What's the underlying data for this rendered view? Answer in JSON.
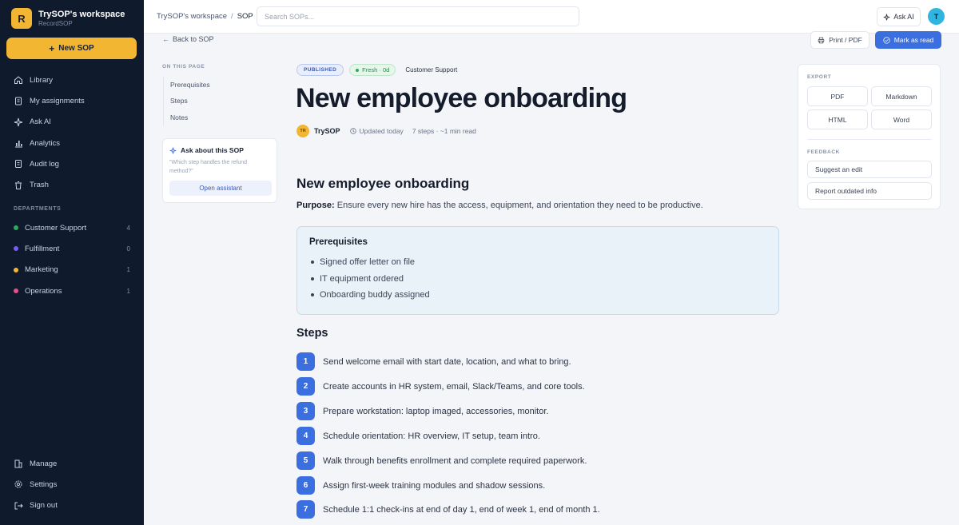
{
  "workspace": {
    "initial": "R",
    "name": "TrySOP's workspace",
    "subtitle": "RecordSOP"
  },
  "sidebar": {
    "new_button": "New SOP",
    "nav": [
      {
        "label": "Library",
        "icon": "home-icon"
      },
      {
        "label": "My assignments",
        "icon": "clipboard-icon"
      },
      {
        "label": "Ask AI",
        "icon": "sparkle-icon"
      },
      {
        "label": "Analytics",
        "icon": "bar-chart-icon"
      },
      {
        "label": "Audit log",
        "icon": "document-icon"
      },
      {
        "label": "Trash",
        "icon": "trash-icon"
      }
    ],
    "departments_title": "DEPARTMENTS",
    "departments": [
      {
        "label": "Customer Support",
        "count": "4",
        "color": "#2fa85a"
      },
      {
        "label": "Fulfillment",
        "count": "0",
        "color": "#7a5cf0"
      },
      {
        "label": "Marketing",
        "count": "1",
        "color": "#f2b632"
      },
      {
        "label": "Operations",
        "count": "1",
        "color": "#e8508a"
      }
    ],
    "bottom": [
      {
        "label": "Manage",
        "icon": "building-icon"
      },
      {
        "label": "Settings",
        "icon": "gear-icon"
      },
      {
        "label": "Sign out",
        "icon": "sign-out-icon"
      }
    ]
  },
  "topbar": {
    "breadcrumb_workspace": "TrySOP's workspace",
    "breadcrumb_sep": "/",
    "breadcrumb_current": "SOP",
    "search_placeholder": "Search SOPs...",
    "ask_ai": "Ask AI",
    "avatar": "T"
  },
  "actions": {
    "back": "Back to SOP",
    "print": "Print / PDF",
    "mark_read": "Mark as read"
  },
  "toc": {
    "title": "ON THIS PAGE",
    "items": [
      "Prerequisites",
      "Steps",
      "Notes"
    ],
    "ask_title": "Ask about this SOP",
    "ask_hint": "\"Which step handles the refund method?\"",
    "ask_button": "Open assistant"
  },
  "sop": {
    "status": "PUBLISHED",
    "freshness": "Fresh · 0d",
    "department": "Customer Support",
    "title": "New employee onboarding",
    "author_initials": "TR",
    "author": "TrySOP",
    "updated": "Updated today",
    "steps_meta": "7 steps · ~1 min read",
    "heading": "New employee onboarding",
    "purpose_label": "Purpose:",
    "purpose": "Ensure every new hire has the access, equipment, and orientation they need to be productive.",
    "prereq_title": "Prerequisites",
    "prerequisites": [
      "Signed offer letter on file",
      "IT equipment ordered",
      "Onboarding buddy assigned"
    ],
    "steps_title": "Steps",
    "steps": [
      {
        "n": "1",
        "text": "Send welcome email with start date, location, and what to bring."
      },
      {
        "n": "2",
        "text": "Create accounts in HR system, email, Slack/Teams, and core tools."
      },
      {
        "n": "3",
        "text": "Prepare workstation: laptop imaged, accessories, monitor."
      },
      {
        "n": "4",
        "text": "Schedule orientation: HR overview, IT setup, team intro."
      },
      {
        "n": "5",
        "text": "Walk through benefits enrollment and complete required paperwork."
      },
      {
        "n": "6",
        "text": "Assign first-week training modules and shadow sessions."
      },
      {
        "n": "7",
        "text": "Schedule 1:1 check-ins at end of day 1, end of week 1, end of month 1."
      }
    ]
  },
  "right_panel": {
    "export_title": "EXPORT",
    "export": [
      "PDF",
      "Markdown",
      "HTML",
      "Word"
    ],
    "feedback_title": "FEEDBACK",
    "feedback": [
      "Suggest an edit",
      "Report outdated info"
    ]
  }
}
